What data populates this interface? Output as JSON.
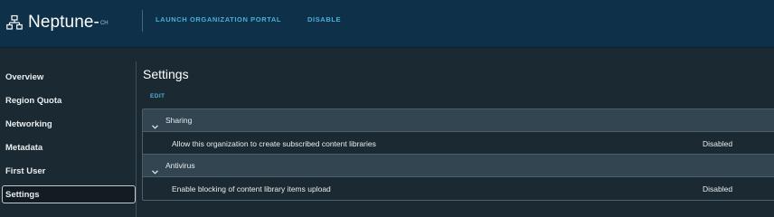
{
  "header": {
    "brand": "Neptune-",
    "brand_suffix": "CH",
    "actions": [
      {
        "label": "LAUNCH ORGANIZATION PORTAL"
      },
      {
        "label": "DISABLE"
      }
    ]
  },
  "sidebar": {
    "items": [
      {
        "label": "Overview"
      },
      {
        "label": "Region Quota"
      },
      {
        "label": "Networking"
      },
      {
        "label": "Metadata"
      },
      {
        "label": "First User"
      },
      {
        "label": "Settings",
        "active": true
      }
    ]
  },
  "main": {
    "title": "Settings",
    "edit_label": "EDIT",
    "groups": [
      {
        "name": "Sharing",
        "rows": [
          {
            "label": "Allow this organization to create subscribed content libraries",
            "value": "Disabled"
          }
        ]
      },
      {
        "name": "Antivirus",
        "rows": [
          {
            "label": "Enable blocking of content library items upload",
            "value": "Disabled"
          }
        ]
      }
    ]
  },
  "colors": {
    "header_bg": "#0e3048",
    "body_bg": "#1b2a32",
    "link": "#49afd9",
    "group_row_bg": "#324550"
  }
}
